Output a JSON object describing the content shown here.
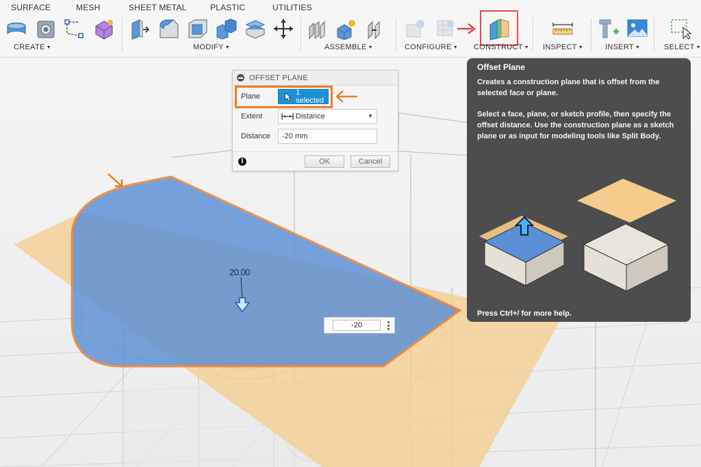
{
  "toolbar": {
    "tabs": [
      "SURFACE",
      "MESH",
      "SHEET METAL",
      "PLASTIC",
      "UTILITIES"
    ],
    "groups": {
      "create": "CREATE",
      "modify": "MODIFY",
      "assemble": "ASSEMBLE",
      "configure": "CONFIGURE",
      "construct": "CONSTRUCT",
      "inspect": "INSPECT",
      "insert": "INSERT",
      "select": "SELECT"
    },
    "highlight_color": "#e8484a"
  },
  "dialog": {
    "title": "OFFSET PLANE",
    "plane_label": "Plane",
    "plane_value": "1 selected",
    "extent_label": "Extent",
    "extent_value": "Distance",
    "distance_label": "Distance",
    "distance_value": "-20 mm",
    "ok_label": "OK",
    "cancel_label": "Cancel"
  },
  "viewport": {
    "dimension_label": "20.00",
    "float_input_value": "-20"
  },
  "tooltip": {
    "title": "Offset Plane",
    "paragraph1": "Creates a construction plane that is offset from the selected face or plane.",
    "paragraph2": "Select a face, plane, or sketch profile, then specify the offset distance. Use the construction plane as a sketch plane or as input for modeling tools like Split Body.",
    "footer": "Press Ctrl+/ for more help."
  },
  "colors": {
    "annotation_orange": "#ef7b25",
    "selection_blue": "#1e90d8",
    "plane_orange": "#f5cc8c",
    "face_blue": "#5b8fd6",
    "tooltip_bg": "#4d4d4d"
  }
}
